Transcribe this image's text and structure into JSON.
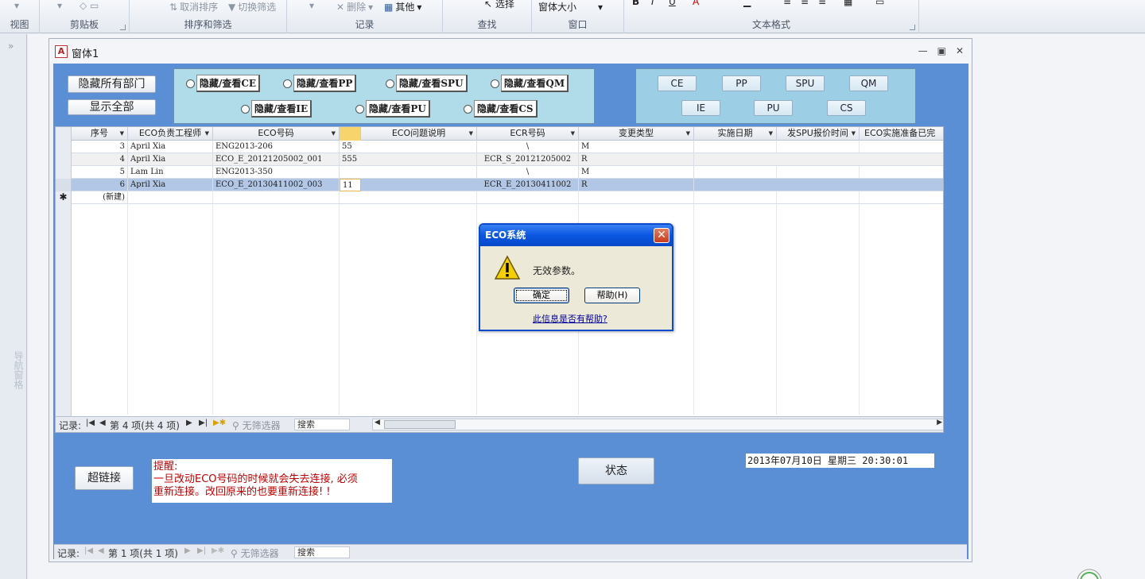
{
  "ribbon": {
    "groups": [
      {
        "label": "视图"
      },
      {
        "label": "剪贴板"
      },
      {
        "label": "排序和筛选"
      },
      {
        "label": "记录"
      },
      {
        "label": "查找"
      },
      {
        "label": "窗口"
      },
      {
        "label": "文本格式"
      }
    ],
    "tools": {
      "clear_sort": "取消排序",
      "toggle_filter": "切换筛选",
      "delete": "删除",
      "other": "其他",
      "window_size": "窗体大小"
    }
  },
  "nav_pane": {
    "label": "导航窗格"
  },
  "form": {
    "title": "窗体1",
    "hide_all_button": "隐藏所有部门",
    "show_all_button": "显示全部",
    "toggles": [
      {
        "label": "隐藏/查看CE"
      },
      {
        "label": "隐藏/查看PP"
      },
      {
        "label": "隐藏/查看SPU"
      },
      {
        "label": "隐藏/查看QM"
      },
      {
        "label": "隐藏/查看IE"
      },
      {
        "label": "隐藏/查看PU"
      },
      {
        "label": "隐藏/查看CS"
      }
    ],
    "dept_buttons": [
      "CE",
      "PP",
      "SPU",
      "QM",
      "IE",
      "PU",
      "CS"
    ]
  },
  "grid": {
    "columns": [
      "序号",
      "ECO负责工程师",
      "ECO号码",
      "",
      "ECO问题说明",
      "ECR号码",
      "变更类型",
      "实施日期",
      "发SPU报价时间",
      "ECO实施准备已完"
    ],
    "rows": [
      {
        "seq": "3",
        "engineer": "April Xia",
        "eco": "ENG2013-206",
        "issue": "55",
        "ecr": "\\",
        "type": "M"
      },
      {
        "seq": "4",
        "engineer": "April Xia",
        "eco": "ECO_E_20121205002_001",
        "issue": "555",
        "ecr": "ECR_S_20121205002",
        "type": "R"
      },
      {
        "seq": "5",
        "engineer": "Lam Lin",
        "eco": "ENG2013-350",
        "issue": "",
        "ecr": "\\",
        "type": "M"
      },
      {
        "seq": "6",
        "engineer": "April Xia",
        "eco": "ECO_E_20130411002_003",
        "issue": "11",
        "ecr": "ECR_E_20130411002",
        "type": "R"
      }
    ],
    "new_row_label": "(新建)",
    "new_row_marker": "✱",
    "nav": {
      "records_label": "记录:",
      "position": "第 4 项(共 4 项)",
      "no_filter": "无筛选器",
      "search_placeholder": "搜索"
    }
  },
  "bottom": {
    "hyperlink_button": "超链接",
    "notice_title": "提醒:",
    "notice_line1": "一旦改动ECO号码的时候就会失去连接, 必须",
    "notice_line2": "重新连接。改回原来的也要重新连接! !",
    "status_button": "状态",
    "clock": "2013年07月10日 星期三 20:30:01",
    "nav": {
      "records_label": "记录:",
      "position": "第 1 项(共 1 项)",
      "no_filter": "无筛选器",
      "search_placeholder": "搜索"
    }
  },
  "dialog": {
    "title": "ECO系统",
    "message": "无效参数。",
    "ok": "确定",
    "help": "帮助(H)",
    "link": "此信息是否有帮助?"
  },
  "colors": {
    "form_background": "#5b8fd5",
    "panel_left": "#b0dbe9",
    "panel_right": "#9ccfe5",
    "notice_text": "#c00000",
    "selected_row": "#b2c7e6",
    "dialog_title": "#0a56e0"
  }
}
